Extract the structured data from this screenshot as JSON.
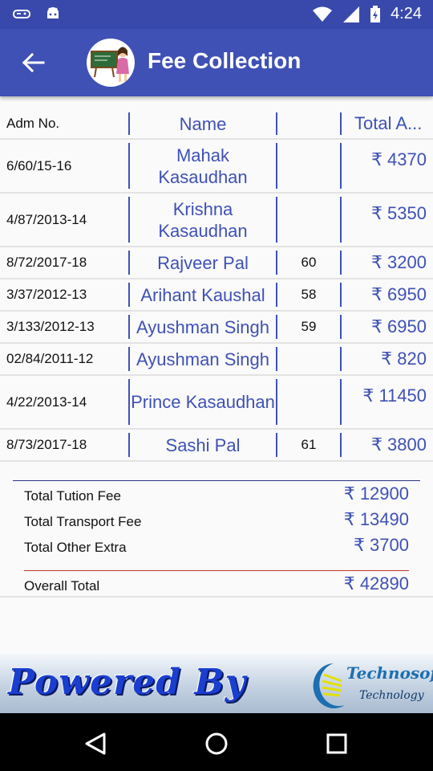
{
  "status_bar": {
    "time": "4:24"
  },
  "app_bar": {
    "title": "Fee Collection",
    "back_icon": "arrow-back-icon",
    "avatar": "teacher-at-blackboard"
  },
  "table": {
    "headers": {
      "adm": "Adm No.",
      "name": "Name",
      "roll": "",
      "amount": "Total A..."
    },
    "rows": [
      {
        "adm": "6/60/15-16",
        "name": "Mahak Kasaudhan",
        "roll": "",
        "amount": "₹ 4370"
      },
      {
        "adm": "4/87/2013-14",
        "name": "Krishna Kasaudhan",
        "roll": "",
        "amount": "₹ 5350"
      },
      {
        "adm": "8/72/2017-18",
        "name": "Rajveer Pal",
        "roll": "60",
        "amount": "₹ 3200"
      },
      {
        "adm": "3/37/2012-13",
        "name": "Arihant Kaushal",
        "roll": "58",
        "amount": "₹ 6950"
      },
      {
        "adm": "3/133/2012-13",
        "name": "Ayushman Singh",
        "roll": "59",
        "amount": "₹ 6950"
      },
      {
        "adm": "02/84/2011-12",
        "name": "Ayushman Singh",
        "roll": "",
        "amount": "₹ 820"
      },
      {
        "adm": "4/22/2013-14",
        "name": "Prince Kasaudhan",
        "roll": "",
        "amount": "₹ 11450"
      },
      {
        "adm": "8/73/2017-18",
        "name": "Sashi Pal",
        "roll": "61",
        "amount": "₹ 3800"
      }
    ]
  },
  "summary": {
    "tuition_label": "Total Tution Fee",
    "tuition_value": "₹ 12900",
    "transport_label": "Total Transport Fee",
    "transport_value": "₹ 13490",
    "other_label": "Total Other Extra",
    "other_value": "₹ 3700",
    "overall_label": "Overall Total",
    "overall_value": "₹ 42890"
  },
  "banner": {
    "powered_by": "Powered By",
    "company_line1": "Technosoft",
    "company_line2": "Technology"
  },
  "colors": {
    "primary": "#3f51b5",
    "status_bar": "#3949ab",
    "divider_red": "#c0392b"
  }
}
